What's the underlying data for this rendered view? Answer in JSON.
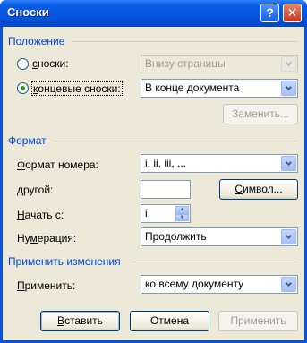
{
  "window": {
    "title": "Сноски",
    "help_icon": "question-mark",
    "close_icon": "x"
  },
  "position": {
    "section_title": "Положение",
    "footnotes": {
      "label_key": "с",
      "label_rest": "носки:",
      "value": "Внизу страницы",
      "checked": false,
      "enabled": false
    },
    "endnotes": {
      "label_key": "к",
      "label_rest": "онцевые сноски:",
      "value": "В конце документа",
      "checked": true,
      "enabled": true
    },
    "replace_button": "Заменить..."
  },
  "format": {
    "section_title": "Формат",
    "number_format": {
      "label_key": "Ф",
      "label_rest": "ормат номера:",
      "value": "i, ii, iii, ..."
    },
    "custom": {
      "label_key": "д",
      "label_rest": "ругой:",
      "value": ""
    },
    "symbol_button_key": "С",
    "symbol_button_rest": "имвол...",
    "start_at": {
      "label_key": "Н",
      "label_rest": "ачать с:",
      "value": "i"
    },
    "numbering": {
      "label_pre": "Ну",
      "label_key": "м",
      "label_rest": "ерация:",
      "value": "Продолжить"
    }
  },
  "apply_changes": {
    "section_title": "Применить изменения",
    "apply_to": {
      "label_key": "П",
      "label_rest": "рименить:",
      "value": "ко всему документу"
    }
  },
  "footer": {
    "insert_key": "В",
    "insert_rest": "ставить",
    "cancel": "Отмена",
    "apply": "Применить"
  },
  "colors": {
    "titlebar": "#0554e0",
    "group_title": "#0046d5",
    "dialog_bg": "#ece9d8",
    "radio_dot": "#21a121",
    "close_button": "#c8381c"
  }
}
